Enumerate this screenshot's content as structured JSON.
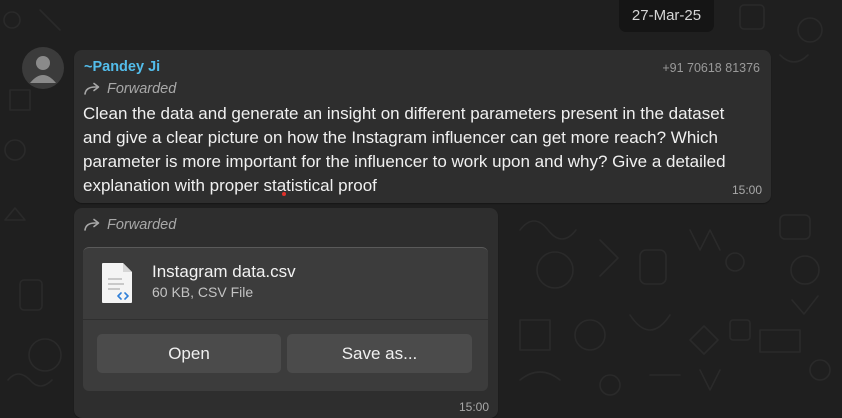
{
  "date_separator": "27-Mar-25",
  "message_1": {
    "sender_name": "~Pandey Ji",
    "sender_phone": "+91 70618 81376",
    "forwarded_label": "Forwarded",
    "text": "Clean the data and generate an insight on different parameters present in the dataset\nand give a clear picture on how the Instagram influencer can get more reach? Which\nparameter is more important for the influencer to work upon and why? Give a detailed\nexplanation with proper statistical proof",
    "time": "15:00"
  },
  "message_2": {
    "forwarded_label": "Forwarded",
    "file": {
      "name": "Instagram data.csv",
      "meta": "60 KB, CSV File",
      "icon": "csv-file-icon"
    },
    "open_label": "Open",
    "save_as_label": "Save as...",
    "time": "15:00"
  },
  "colors": {
    "background": "#1f1f1f",
    "bubble": "#2e2e2e",
    "sender_name": "#53bdeb",
    "file_card": "#3c3c3c",
    "button": "#4b4b4b"
  }
}
